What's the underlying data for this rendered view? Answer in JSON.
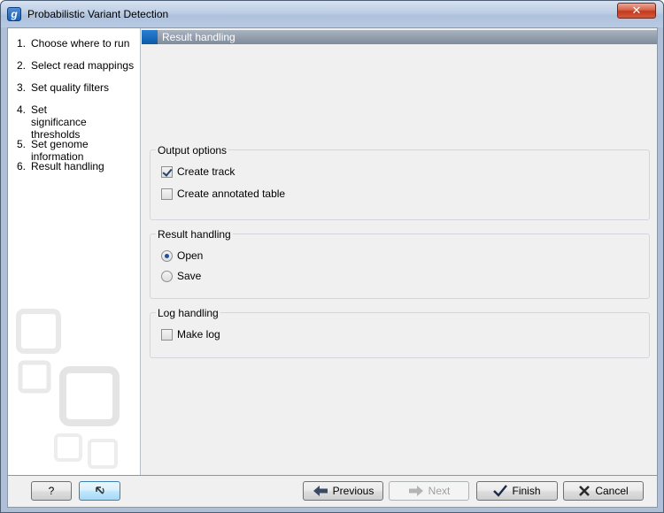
{
  "window": {
    "title": "Probabilistic Variant Detection",
    "app_icon_letter": "g",
    "close_glyph": "✕"
  },
  "steps": [
    {
      "num": "1.",
      "label": "Choose where to run"
    },
    {
      "num": "2.",
      "label": "Select read mappings"
    },
    {
      "num": "3.",
      "label": "Set quality filters"
    },
    {
      "num": "4.",
      "label": "Set significance thresholds"
    },
    {
      "num": "5.",
      "label": "Set genome information"
    },
    {
      "num": "6.",
      "label": "Result handling"
    }
  ],
  "header": {
    "title": "Result handling"
  },
  "output_options": {
    "title": "Output options",
    "create_track": {
      "label": "Create track",
      "checked": true
    },
    "create_table": {
      "label": "Create annotated table",
      "checked": false
    }
  },
  "result_handling": {
    "title": "Result handling",
    "open": {
      "label": "Open",
      "selected": true
    },
    "save": {
      "label": "Save",
      "selected": false
    }
  },
  "log_handling": {
    "title": "Log handling",
    "make_log": {
      "label": "Make log",
      "checked": false
    }
  },
  "footer": {
    "help_label": "?",
    "reset_icon": "reset-arrow-icon",
    "previous_label": "Previous",
    "next_label": "Next",
    "finish_label": "Finish",
    "cancel_label": "Cancel"
  },
  "colors": {
    "header_accent": "#0b5aa8",
    "cancel_x": "#c0392b",
    "finish_check": "#1c2a44"
  }
}
